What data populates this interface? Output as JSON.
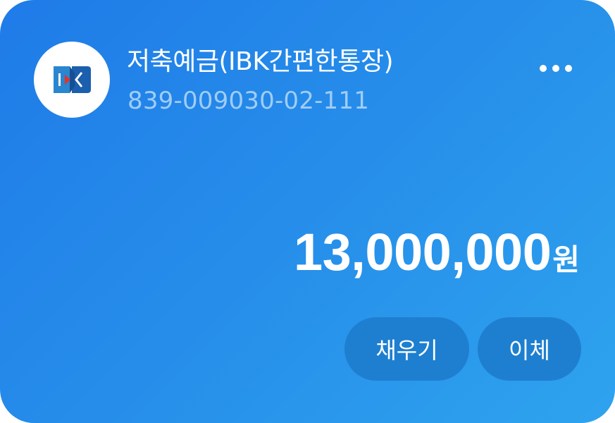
{
  "account": {
    "name": "저축예금(IBK간편한통장)",
    "number": "839-009030-02-111",
    "bank_logo_icon": "ibk-logo-icon"
  },
  "menu": {
    "more_icon": "more-horizontal-icon"
  },
  "balance": {
    "amount": "13,000,000",
    "unit": "원"
  },
  "actions": {
    "fill_label": "채우기",
    "transfer_label": "이체"
  },
  "colors": {
    "card_gradient_start": "#1f7be8",
    "card_gradient_end": "#2ea3ee",
    "button_background": "#1e7fd0",
    "account_number_text": "#9fcdf6",
    "logo_blue": "#1b63b8",
    "logo_red": "#e3322b"
  }
}
